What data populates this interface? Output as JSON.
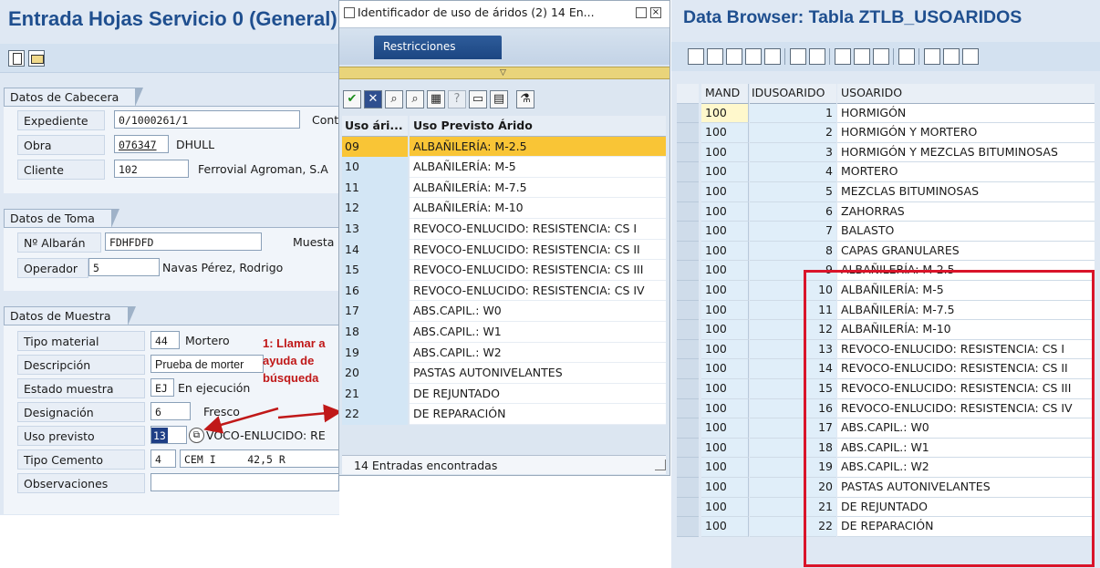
{
  "left": {
    "title": "Entrada Hojas Servicio 0 (General)",
    "cabecera": {
      "tab": "Datos de Cabecera",
      "expediente_label": "Expediente",
      "expediente_value": "0/1000261/1",
      "cont_label": "Cont",
      "obra_label": "Obra",
      "obra_value": "076347",
      "obra_desc": "DHULL",
      "cliente_label": "Cliente",
      "cliente_value": "102",
      "cliente_desc": "Ferrovial Agroman, S.A"
    },
    "toma": {
      "tab": "Datos de Toma",
      "albaran_label": "Nº Albarán",
      "albaran_value": "FDHFDFD",
      "muestra_label": "Muesta",
      "operador_label": "Operador",
      "operador_value": "5",
      "operador_desc": "Navas Pérez, Rodrigo"
    },
    "muestra": {
      "tab": "Datos de Muestra",
      "tipo_material_label": "Tipo material",
      "tipo_material_value": "44",
      "tipo_material_desc": "Mortero",
      "descripcion_label": "Descripción",
      "descripcion_value": "Prueba de morter",
      "estado_label": "Estado muestra",
      "estado_value": "EJ",
      "estado_desc": "En ejecución",
      "designacion_label": "Designación",
      "designacion_value": "6",
      "designacion_desc": "Fresco",
      "uso_label": "Uso previsto",
      "uso_value": "13",
      "uso_desc": "VOCO-ENLUCIDO: RE",
      "cemento_label": "Tipo Cemento",
      "cemento_value": "4",
      "cemento_desc": "CEM I     42,5 R",
      "observaciones_label": "Observaciones"
    },
    "annotation": [
      "1: Llamar a",
      "ayuda de",
      "búsqueda"
    ]
  },
  "popup": {
    "title": "Identificador de uso de áridos (2)   14 En...",
    "restricciones_tab": "Restricciones",
    "col_code": "Uso ári...",
    "col_desc": "Uso Previsto Árido",
    "rows": [
      {
        "code": "09",
        "desc": "ALBAÑILERÍA: M-2.5"
      },
      {
        "code": "10",
        "desc": "ALBAÑILERÍA: M-5"
      },
      {
        "code": "11",
        "desc": "ALBAÑILERÍA: M-7.5"
      },
      {
        "code": "12",
        "desc": "ALBAÑILERÍA: M-10"
      },
      {
        "code": "13",
        "desc": "REVOCO-ENLUCIDO: RESISTENCIA: CS I"
      },
      {
        "code": "14",
        "desc": "REVOCO-ENLUCIDO: RESISTENCIA: CS II"
      },
      {
        "code": "15",
        "desc": "REVOCO-ENLUCIDO: RESISTENCIA: CS III"
      },
      {
        "code": "16",
        "desc": "REVOCO-ENLUCIDO: RESISTENCIA: CS IV"
      },
      {
        "code": "17",
        "desc": "ABS.CAPIL.: W0"
      },
      {
        "code": "18",
        "desc": "ABS.CAPIL.: W1"
      },
      {
        "code": "19",
        "desc": "ABS.CAPIL.: W2"
      },
      {
        "code": "20",
        "desc": "PASTAS AUTONIVELANTES"
      },
      {
        "code": "21",
        "desc": "DE REJUNTADO"
      },
      {
        "code": "22",
        "desc": "DE REPARACIÓN"
      }
    ],
    "selected_code": "09",
    "status": "14 Entradas encontradas"
  },
  "right": {
    "title": "Data Browser: Tabla ZTLB_USOARIDOS",
    "col_mand": "MAND",
    "col_id": "IDUSOARIDO",
    "col_desc": "USOARIDO",
    "rows": [
      {
        "mand": "100",
        "id": "1",
        "desc": "HORMIGÓN"
      },
      {
        "mand": "100",
        "id": "2",
        "desc": "HORMIGÓN Y MORTERO"
      },
      {
        "mand": "100",
        "id": "3",
        "desc": "HORMIGÓN Y MEZCLAS BITUMINOSAS"
      },
      {
        "mand": "100",
        "id": "4",
        "desc": "MORTERO"
      },
      {
        "mand": "100",
        "id": "5",
        "desc": "MEZCLAS BITUMINOSAS"
      },
      {
        "mand": "100",
        "id": "6",
        "desc": "ZAHORRAS"
      },
      {
        "mand": "100",
        "id": "7",
        "desc": "BALASTO"
      },
      {
        "mand": "100",
        "id": "8",
        "desc": "CAPAS GRANULARES"
      },
      {
        "mand": "100",
        "id": "9",
        "desc": "ALBAÑILERÍA: M-2.5"
      },
      {
        "mand": "100",
        "id": "10",
        "desc": "ALBAÑILERÍA: M-5"
      },
      {
        "mand": "100",
        "id": "11",
        "desc": "ALBAÑILERÍA: M-7.5"
      },
      {
        "mand": "100",
        "id": "12",
        "desc": "ALBAÑILERÍA: M-10"
      },
      {
        "mand": "100",
        "id": "13",
        "desc": "REVOCO-ENLUCIDO: RESISTENCIA: CS I"
      },
      {
        "mand": "100",
        "id": "14",
        "desc": "REVOCO-ENLUCIDO: RESISTENCIA: CS II"
      },
      {
        "mand": "100",
        "id": "15",
        "desc": "REVOCO-ENLUCIDO: RESISTENCIA: CS III"
      },
      {
        "mand": "100",
        "id": "16",
        "desc": "REVOCO-ENLUCIDO: RESISTENCIA: CS IV"
      },
      {
        "mand": "100",
        "id": "17",
        "desc": "ABS.CAPIL.: W0"
      },
      {
        "mand": "100",
        "id": "18",
        "desc": "ABS.CAPIL.: W1"
      },
      {
        "mand": "100",
        "id": "19",
        "desc": "ABS.CAPIL.: W2"
      },
      {
        "mand": "100",
        "id": "20",
        "desc": "PASTAS AUTONIVELANTES"
      },
      {
        "mand": "100",
        "id": "21",
        "desc": "DE REJUNTADO"
      },
      {
        "mand": "100",
        "id": "22",
        "desc": "DE REPARACIÓN"
      }
    ]
  },
  "colors": {
    "title_blue": "#1f4f8f",
    "selection_yellow": "#f9c536",
    "annotation_red": "#c01818",
    "highlight_box_red": "#d9142a"
  }
}
